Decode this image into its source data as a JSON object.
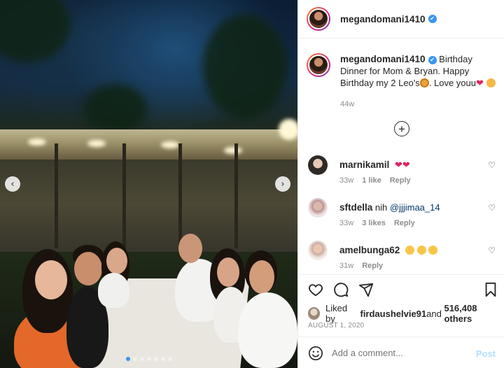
{
  "post": {
    "author": "megandomani1410",
    "carousel": {
      "count": 7,
      "active_index": 0
    }
  },
  "caption": {
    "author": "megandomani1410",
    "text_1": "Birthday Dinner for Mom & Bryan. Happy Birthday my 2 Leo's",
    "text_2": ". Love youu",
    "time": "44w"
  },
  "comments": [
    {
      "author": "marnikamil",
      "text": "",
      "time": "33w",
      "likes": "1 like",
      "reply": "Reply"
    },
    {
      "author": "sftdella",
      "text": "nih ",
      "mention": "@jjjimaa_14",
      "time": "33w",
      "likes": "3 likes",
      "reply": "Reply"
    },
    {
      "author": "amelbunga62",
      "text": "",
      "time": "31w",
      "reply": "Reply"
    }
  ],
  "likes": {
    "prefix": "Liked by ",
    "user": "firdaushelvie91",
    "middle": " and ",
    "count": "516,408 others"
  },
  "date": "AUGUST 1, 2020",
  "add_comment": {
    "placeholder": "Add a comment...",
    "post_label": "Post"
  },
  "icons": [
    "heart-icon",
    "comment-icon",
    "share-icon",
    "bookmark-icon",
    "smile-icon",
    "plus-icon",
    "chevron-left-icon",
    "chevron-right-icon",
    "verified-icon"
  ]
}
